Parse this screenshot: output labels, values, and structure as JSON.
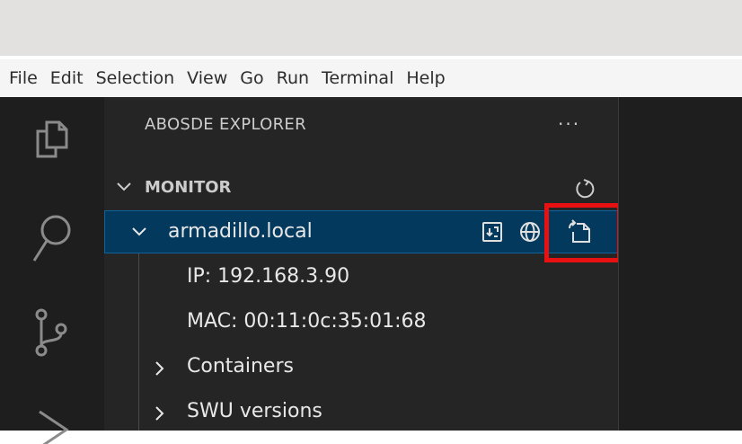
{
  "menubar": {
    "items": [
      "File",
      "Edit",
      "Selection",
      "View",
      "Go",
      "Run",
      "Terminal",
      "Help"
    ]
  },
  "activity_bar": {
    "icons": [
      "files-icon",
      "search-icon",
      "source-control-icon",
      "run-debug-icon"
    ]
  },
  "sidebar": {
    "title": "ABOSDE EXPLORER",
    "more_actions": "···",
    "section": {
      "label": "MONITOR",
      "refresh_icon": "refresh-icon"
    },
    "device": {
      "label": "armadillo.local",
      "actions": [
        "open-in-terminal-icon",
        "open-in-browser-icon",
        "update-software-icon"
      ],
      "ip": "IP: 192.168.3.90",
      "mac": "MAC: 00:11:0c:35:01:68",
      "children": [
        "Containers",
        "SWU versions"
      ]
    }
  },
  "colors": {
    "activity_bar": "#1e1e1e",
    "sidebar": "#252526",
    "selected_row": "#04395e",
    "highlight": "#e81010"
  }
}
